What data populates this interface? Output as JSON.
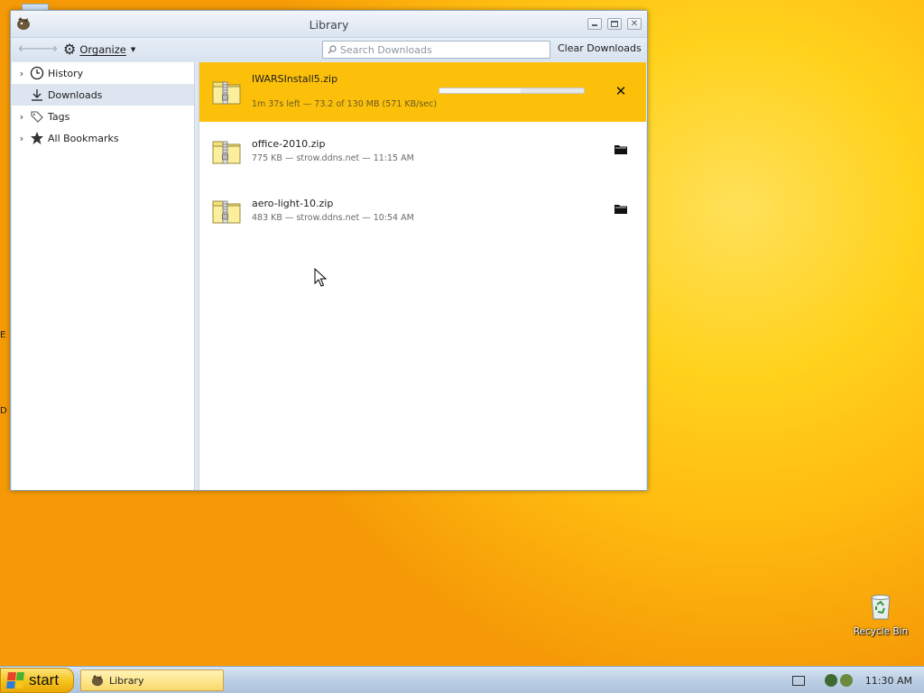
{
  "window": {
    "title": "Library"
  },
  "toolbar": {
    "organize_label": "Organize",
    "search_placeholder": "Search Downloads",
    "clear_label": "Clear Downloads"
  },
  "sidebar": {
    "items": [
      {
        "label": "History",
        "icon": "clock-icon",
        "expandable": true,
        "selected": false
      },
      {
        "label": "Downloads",
        "icon": "download-arrow-icon",
        "expandable": false,
        "selected": true
      },
      {
        "label": "Tags",
        "icon": "tag-icon",
        "expandable": true,
        "selected": false
      },
      {
        "label": "All Bookmarks",
        "icon": "star-icon",
        "expandable": true,
        "selected": false
      }
    ]
  },
  "downloads": [
    {
      "name": "IWARSInstall5.zip",
      "status": "1m 37s left — 73.2 of 130 MB (571 KB/sec)",
      "state": "in-progress",
      "progress": 0.56,
      "action_icon": "cancel-icon"
    },
    {
      "name": "office-2010.zip",
      "status": "775 KB — strow.ddns.net — 11:15 AM",
      "state": "done",
      "action_icon": "folder-icon"
    },
    {
      "name": "aero-light-10.zip",
      "status": "483 KB — strow.ddns.net — 10:54 AM",
      "state": "done",
      "action_icon": "folder-icon"
    }
  ],
  "desktop": {
    "recycle_bin_label": "Recycle Bin"
  },
  "taskbar": {
    "start_label": "start",
    "task_label": "Library",
    "clock": "11:30 AM"
  },
  "colors": {
    "active_download": "#fcc00a",
    "selected_sidebar": "#dde6f0",
    "desktop_accent": "#ffd21c"
  }
}
